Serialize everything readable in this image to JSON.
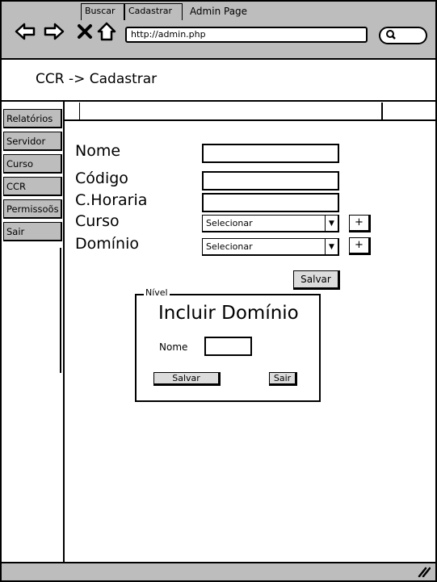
{
  "browser": {
    "title": "Admin Page",
    "url": "http://admin.php",
    "icons": [
      "back-arrow-icon",
      "forward-arrow-icon",
      "close-icon",
      "home-icon",
      "search-icon"
    ]
  },
  "header": {
    "title": "CCR -> Cadastrar"
  },
  "tabs": [
    {
      "label": "Buscar"
    },
    {
      "label": "Cadastrar"
    }
  ],
  "sidebar": {
    "items": [
      {
        "label": "Relatórios"
      },
      {
        "label": "Servidor"
      },
      {
        "label": "Curso"
      },
      {
        "label": "CCR"
      },
      {
        "label": "Permissoõs"
      },
      {
        "label": "Sair"
      }
    ]
  },
  "form": {
    "fields": [
      {
        "label": "Nome",
        "value": ""
      },
      {
        "label": "Código",
        "value": ""
      },
      {
        "label": "C.Horaria",
        "value": ""
      },
      {
        "label": "Curso",
        "selected": "Selecionar"
      },
      {
        "label": "Domínio",
        "selected": "Selecionar"
      }
    ],
    "plus_label": "+",
    "save_label": "Salvar"
  },
  "panel": {
    "legend": "Nível",
    "title": "Incluir Domínio",
    "name_label": "Nome",
    "name_value": "",
    "save_label": "Salvar",
    "exit_label": "Sair"
  },
  "colors": {
    "chrome": "#bdbdbd",
    "button": "#dcdcdc",
    "border": "#000000"
  }
}
